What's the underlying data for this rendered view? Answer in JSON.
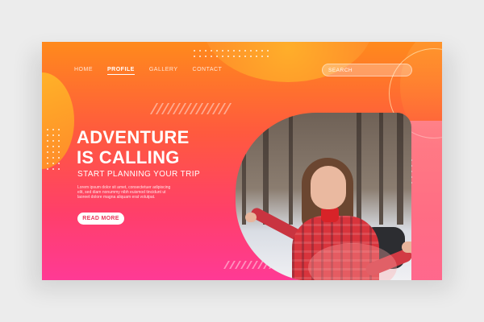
{
  "colors": {
    "gradient_top": "#ff8a1c",
    "gradient_bottom": "#ff3a95",
    "cta_text": "#e8365a",
    "text": "#ffffff"
  },
  "nav": {
    "items": [
      {
        "label": "HOME",
        "active": false
      },
      {
        "label": "PROFILE",
        "active": true
      },
      {
        "label": "GALLERY",
        "active": false
      },
      {
        "label": "CONTACT",
        "active": false
      }
    ]
  },
  "search": {
    "placeholder": "SEARCH",
    "value": ""
  },
  "hero": {
    "title_line1": "ADVENTURE",
    "title_line2": "IS CALLING",
    "subtitle": "START PLANNING YOUR TRIP",
    "body_lines": [
      "Lorem ipsum dolor sit amet, consectetuer adipiscing",
      "elit, sed diam nonummy nibh euismod tincidunt ut",
      "laoreet dolore magna aliquam erat volutpat."
    ],
    "cta_label": "READ MORE"
  },
  "photo": {
    "icon": "traveler-photo"
  }
}
